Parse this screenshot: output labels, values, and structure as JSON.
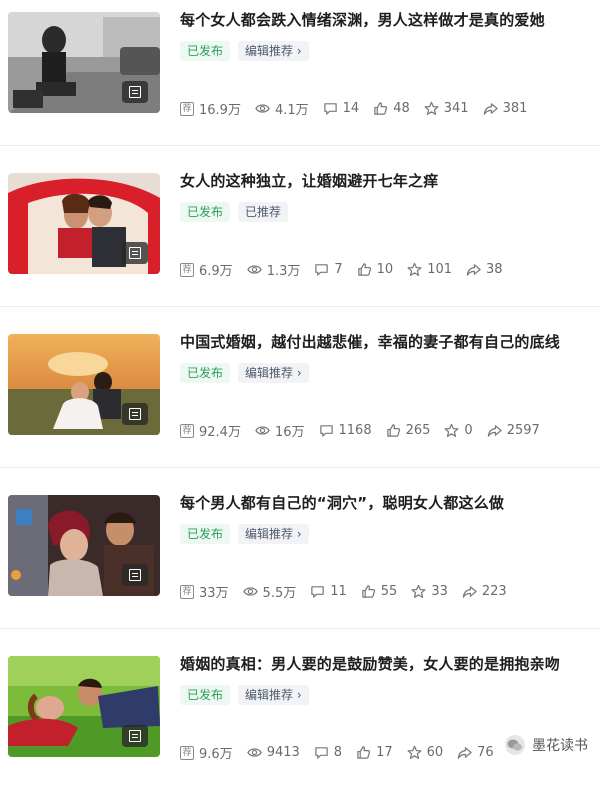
{
  "articles": [
    {
      "title": "每个女人都会跌入情绪深渊，男人这样做才是真的爱她",
      "tags": [
        "已发布",
        "编辑推荐 ›"
      ],
      "stats": {
        "recommend": "16.9万",
        "views": "4.1万",
        "comments": "14",
        "likes": "48",
        "favorites": "341",
        "shares": "381"
      },
      "recommend_icon_label": "荐"
    },
    {
      "title": "女人的这种独立，让婚姻避开七年之痒",
      "tags": [
        "已发布",
        "已推荐"
      ],
      "stats": {
        "recommend": "6.9万",
        "views": "1.3万",
        "comments": "7",
        "likes": "10",
        "favorites": "101",
        "shares": "38"
      },
      "recommend_icon_label": "荐"
    },
    {
      "title": "中国式婚姻，越付出越悲催，幸福的妻子都有自己的底线",
      "tags": [
        "已发布",
        "编辑推荐 ›"
      ],
      "stats": {
        "recommend": "92.4万",
        "views": "16万",
        "comments": "1168",
        "likes": "265",
        "favorites": "0",
        "shares": "2597"
      },
      "recommend_icon_label": "荐"
    },
    {
      "title": "每个男人都有自己的“洞穴”，聪明女人都这么做",
      "tags": [
        "已发布",
        "编辑推荐 ›"
      ],
      "stats": {
        "recommend": "33万",
        "views": "5.5万",
        "comments": "11",
        "likes": "55",
        "favorites": "33",
        "shares": "223"
      },
      "recommend_icon_label": "荐"
    },
    {
      "title": "婚姻的真相：男人要的是鼓励赞美，女人要的是拥抱亲吻",
      "tags": [
        "已发布",
        "编辑推荐 ›"
      ],
      "stats": {
        "recommend": "9.6万",
        "views": "9413",
        "comments": "8",
        "likes": "17",
        "favorites": "60",
        "shares": "76"
      },
      "recommend_icon_label": "荐"
    }
  ],
  "watermark": {
    "text": "墨花读书"
  },
  "colors": {
    "published_text": "#2aa05a",
    "published_bg": "#eef8f2",
    "recommend_text": "#4f5b6e",
    "recommend_bg": "#f1f3f6",
    "stat_text": "#6b6b6b",
    "divider": "#ececec"
  }
}
